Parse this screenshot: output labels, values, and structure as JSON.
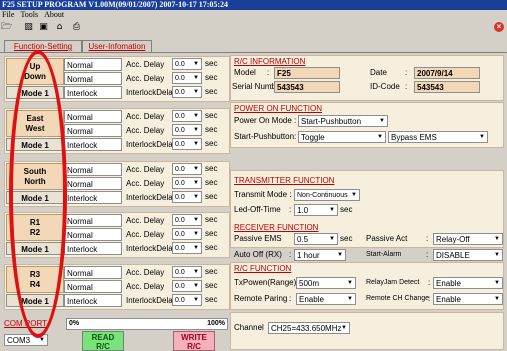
{
  "window": {
    "title": "F25 SETUP PROGRAM V1.00M(09/01/2007)  2007-10-17  17:05:24"
  },
  "menu": {
    "file": "File",
    "tools": "Tools",
    "about": "About"
  },
  "toolbar": {
    "icons": [
      "open-folder-icon",
      "save-icon",
      "floppy-icon",
      "home-icon",
      "print-icon"
    ],
    "close": "×"
  },
  "tabs": {
    "function_setting": "Function-Setting",
    "user_information": "User-Infomation"
  },
  "groups": [
    {
      "dir1": "Up",
      "dir2": "Down",
      "mode": "Mode 1",
      "row1": "Normal",
      "row2": "Normal",
      "row3": "Interlock",
      "lbl1": "Acc. Delay",
      "lbl2": "Acc. Delay",
      "lbl3": "InterlockDelay",
      "v1": "0.0",
      "v2": "0.0",
      "v3": "0.0"
    },
    {
      "dir1": "East",
      "dir2": "West",
      "mode": "Mode 1",
      "row1": "Normal",
      "row2": "Normal",
      "row3": "Interlock",
      "lbl1": "Acc. Delay",
      "lbl2": "Acc. Delay",
      "lbl3": "InterlockDelay",
      "v1": "0.0",
      "v2": "0.0",
      "v3": "0.0"
    },
    {
      "dir1": "South",
      "dir2": "North",
      "mode": "Mode 1",
      "row1": "Normal",
      "row2": "Normal",
      "row3": "Interlock",
      "lbl1": "Acc. Delay",
      "lbl2": "Acc. Delay",
      "lbl3": "InterlockDelay",
      "v1": "0.0",
      "v2": "0.0",
      "v3": "0.0"
    },
    {
      "dir1": "R1",
      "dir2": "R2",
      "mode": "Mode 1",
      "row1": "Normal",
      "row2": "Normal",
      "row3": "Interlock",
      "lbl1": "Acc. Delay",
      "lbl2": "Acc. Delay",
      "lbl3": "InterlockDelay",
      "v1": "0.0",
      "v2": "0.0",
      "v3": "0.0"
    },
    {
      "dir1": "R3",
      "dir2": "R4",
      "mode": "Mode 1",
      "row1": "Normal",
      "row2": "Normal",
      "row3": "Interlock",
      "lbl1": "Acc. Delay",
      "lbl2": "Acc. Delay",
      "lbl3": "InterlockDelay",
      "v1": "0.0",
      "v2": "0.0",
      "v3": "0.0"
    }
  ],
  "sec": "sec",
  "rc_info": {
    "header": "R/C INFORMATION",
    "model_label": "Model",
    "model": "F25",
    "date_label": "Date",
    "date": "2007/9/14",
    "serial_label": "Serial Number",
    "serial": "543543",
    "id_label": "ID-Code",
    "id": "543543"
  },
  "power_on": {
    "header": "POWER ON FUNCTION",
    "mode_label": "Power On Mode :",
    "mode": "Start-Pushbutton",
    "sp_label": "Start-Pushbutton:",
    "sp": "Toggle",
    "bypass": "Bypass EMS"
  },
  "transmitter": {
    "header": "TRANSMITTER FUNCTION",
    "tm_label": "Transmit Mode :",
    "tm": "Non-Continuous",
    "led_label": "Led-Off-Time",
    "led": "1.0",
    "led_unit": "sec"
  },
  "receiver": {
    "header": "RECEIVER FUNCTION",
    "pems_label": "Passive EMS",
    "pems": "0.5",
    "pems_unit": "sec",
    "pact_label": "Passive Act",
    "pact": "Relay-Off",
    "auto_label": "Auto Off (RX)",
    "auto": "1 hour",
    "alarm_label": "Start-Alarm",
    "alarm": "DISABLE"
  },
  "rc_function": {
    "header": "R/C FUNCTION",
    "txp_label": "TxPowen(Range)",
    "txp": "500m",
    "jam_label": "RelayJam Detect",
    "jam": "Enable",
    "paring_label": "Remote Paring",
    "paring": "Enable",
    "chchange_label": "Remote CH Change",
    "chchange": "Enable"
  },
  "channel": {
    "label": "Channel",
    "value": "CH25=433.650MHz"
  },
  "com": {
    "label": "COM PORT",
    "value": "COM3"
  },
  "progress": {
    "left_label": "0%",
    "right_label": "100%",
    "value": 0
  },
  "buttons": {
    "read_line1": "READ",
    "read_line2": "R/C",
    "write_line1": "WRITE",
    "write_line2": "R/C"
  }
}
